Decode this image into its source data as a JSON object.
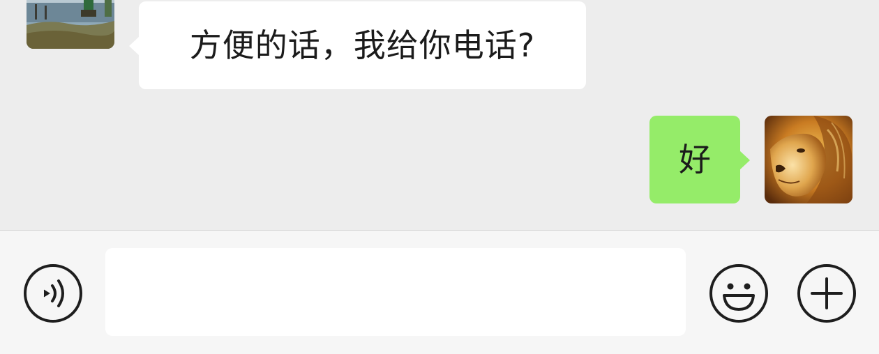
{
  "messages": [
    {
      "direction": "incoming",
      "text": "方便的话，我给你电话?"
    },
    {
      "direction": "outgoing",
      "text": "好"
    }
  ],
  "avatars": {
    "contact": "landscape-photo-avatar",
    "self": "lion-photo-avatar"
  },
  "input_bar": {
    "voice_icon": "voice-icon",
    "message_value": "",
    "emoji_icon": "emoji-icon",
    "more_icon": "plus-icon"
  },
  "colors": {
    "background": "#ededed",
    "incoming_bubble": "#ffffff",
    "outgoing_bubble": "#95ec69",
    "input_bar": "#f6f6f6",
    "icon_stroke": "#1e1e1e"
  }
}
